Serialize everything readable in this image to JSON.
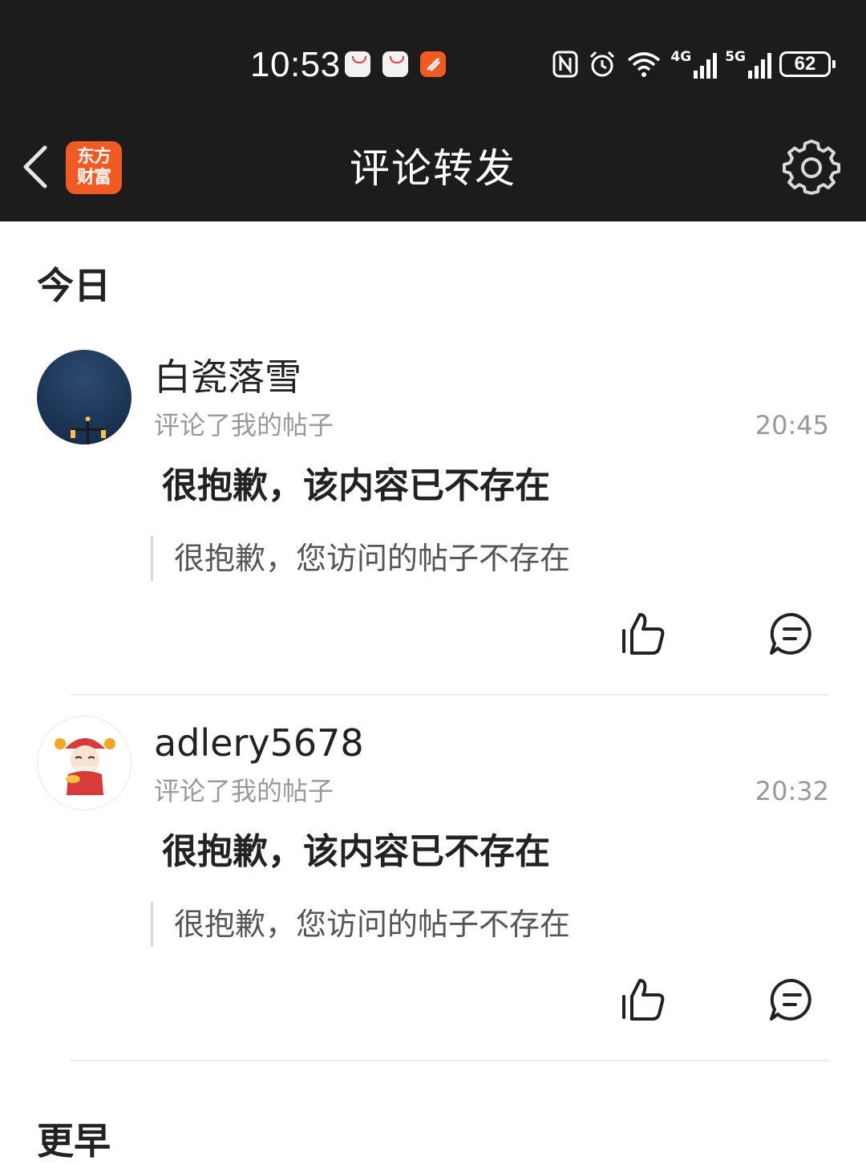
{
  "status_bar": {
    "time": "10:53",
    "notification_icons": [
      "huawei-app-icon",
      "huawei-app-icon",
      "orange-app-icon"
    ],
    "system_icons": [
      "nfc-icon",
      "alarm-icon",
      "wifi-icon",
      "4g-signal-icon",
      "5g-signal-icon"
    ],
    "network_4g": "4G",
    "network_5g": "5G",
    "battery": "62"
  },
  "header": {
    "back_icon": "chevron-left-icon",
    "app_logo_line1": "东方",
    "app_logo_line2": "财富",
    "title": "评论转发",
    "settings_icon": "gear-icon"
  },
  "sections": [
    {
      "title": "今日",
      "items": [
        {
          "username": "白瓷落雪",
          "action": "评论了我的帖子",
          "time": "20:45",
          "comment": "很抱歉，该内容已不存在",
          "quote": "很抱歉，您访问的帖子不存在"
        },
        {
          "username": "adlery5678",
          "action": "评论了我的帖子",
          "time": "20:32",
          "comment": "很抱歉，该内容已不存在",
          "quote": "很抱歉，您访问的帖子不存在"
        }
      ]
    },
    {
      "title": "更早"
    }
  ],
  "colors": {
    "bar_background": "#1c1c1c",
    "brand_orange": "#f15a22",
    "secondary_text": "#999999"
  }
}
